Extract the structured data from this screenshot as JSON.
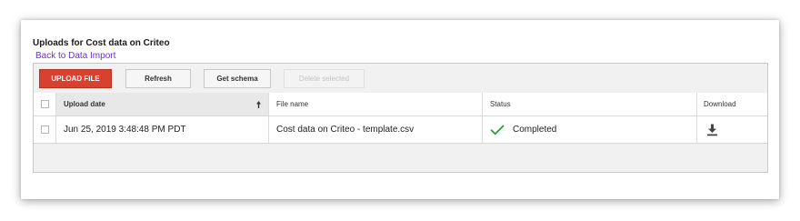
{
  "page": {
    "title": "Uploads for Cost data on Criteo",
    "back_link": "Back to Data Import"
  },
  "toolbar": {
    "upload_label": "UPLOAD FILE",
    "refresh_label": "Refresh",
    "schema_label": "Get schema",
    "delete_label": "Delete selected"
  },
  "table": {
    "columns": {
      "upload_date": "Upload date",
      "file_name": "File name",
      "status": "Status",
      "download": "Download"
    },
    "sort": {
      "column": "upload_date",
      "icon": "arrow-up-icon"
    },
    "rows": [
      {
        "upload_date": "Jun 25, 2019 3:48:48 PM PDT",
        "file_name": "Cost data on Criteo - template.csv",
        "status": "Completed",
        "status_icon": "check-icon",
        "download_icon": "download-icon"
      }
    ]
  },
  "colors": {
    "upload_button": "#d8412f",
    "link": "#6b2fd6",
    "success": "#2e9d3a"
  }
}
